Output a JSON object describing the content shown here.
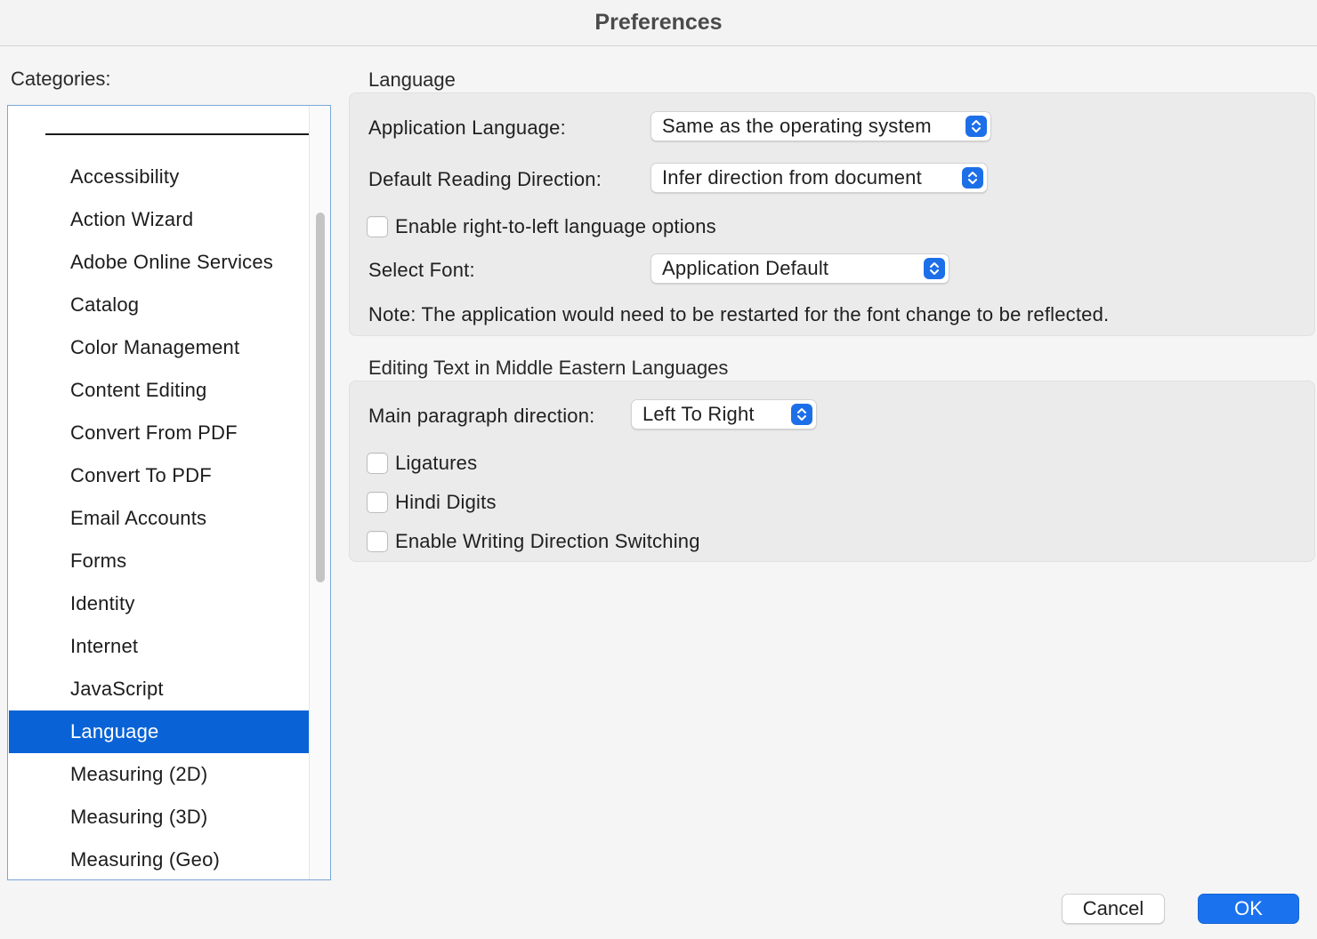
{
  "window": {
    "title": "Preferences"
  },
  "categories": {
    "label": "Categories:",
    "items": [
      {
        "label": "Accessibility",
        "selected": false
      },
      {
        "label": "Action Wizard",
        "selected": false
      },
      {
        "label": "Adobe Online Services",
        "selected": false
      },
      {
        "label": "Catalog",
        "selected": false
      },
      {
        "label": "Color Management",
        "selected": false
      },
      {
        "label": "Content Editing",
        "selected": false
      },
      {
        "label": "Convert From PDF",
        "selected": false
      },
      {
        "label": "Convert To PDF",
        "selected": false
      },
      {
        "label": "Email Accounts",
        "selected": false
      },
      {
        "label": "Forms",
        "selected": false
      },
      {
        "label": "Identity",
        "selected": false
      },
      {
        "label": "Internet",
        "selected": false
      },
      {
        "label": "JavaScript",
        "selected": false
      },
      {
        "label": "Language",
        "selected": true
      },
      {
        "label": "Measuring (2D)",
        "selected": false
      },
      {
        "label": "Measuring (3D)",
        "selected": false
      },
      {
        "label": "Measuring (Geo)",
        "selected": false
      }
    ]
  },
  "language_section": {
    "title": "Language",
    "app_language": {
      "label": "Application Language:",
      "value": "Same as the operating system"
    },
    "reading_direction": {
      "label": "Default Reading Direction:",
      "value": "Infer direction from document"
    },
    "rtl_checkbox": {
      "label": "Enable right-to-left language options",
      "checked": false
    },
    "font": {
      "label": "Select Font:",
      "value": "Application Default"
    },
    "note": "Note: The application would need to be restarted for the font change to be reflected."
  },
  "middle_eastern_section": {
    "title": "Editing Text in Middle Eastern Languages",
    "paragraph_direction": {
      "label": "Main paragraph direction:",
      "value": "Left To Right"
    },
    "ligatures": {
      "label": "Ligatures",
      "checked": false
    },
    "hindi_digits": {
      "label": "Hindi Digits",
      "checked": false
    },
    "writing_direction": {
      "label": "Enable Writing Direction Switching",
      "checked": false
    }
  },
  "buttons": {
    "cancel": "Cancel",
    "ok": "OK"
  },
  "colors": {
    "selection": "#0a63d6",
    "accent": "#1a72ee",
    "stepper": "#1d6fe8"
  }
}
